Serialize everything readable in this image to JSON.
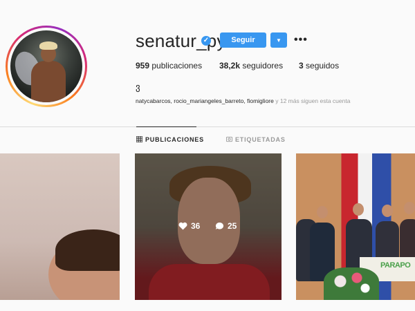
{
  "profile": {
    "username": "senatur_py",
    "follow_label": "Seguir",
    "more_label": "•••",
    "bio": "ვ"
  },
  "stats": {
    "posts_count": "959",
    "posts_label": "publicaciones",
    "followers_count": "38,2k",
    "followers_label": "seguidores",
    "following_count": "3",
    "following_label": "seguidos"
  },
  "followed_by": {
    "names": "natycabarcos, rocio_mariangeles_barreto, fiomigliore",
    "more": "y 12 más siguen esta cuenta"
  },
  "tabs": {
    "posts": "PUBLICACIONES",
    "tagged": "ETIQUETADAS"
  },
  "posts": [
    {},
    {
      "likes": "36",
      "comments": "25"
    },
    {
      "banner": "PARAPO"
    }
  ],
  "colors": {
    "accent": "#3897f0",
    "text": "#262626",
    "muted": "#999999"
  }
}
